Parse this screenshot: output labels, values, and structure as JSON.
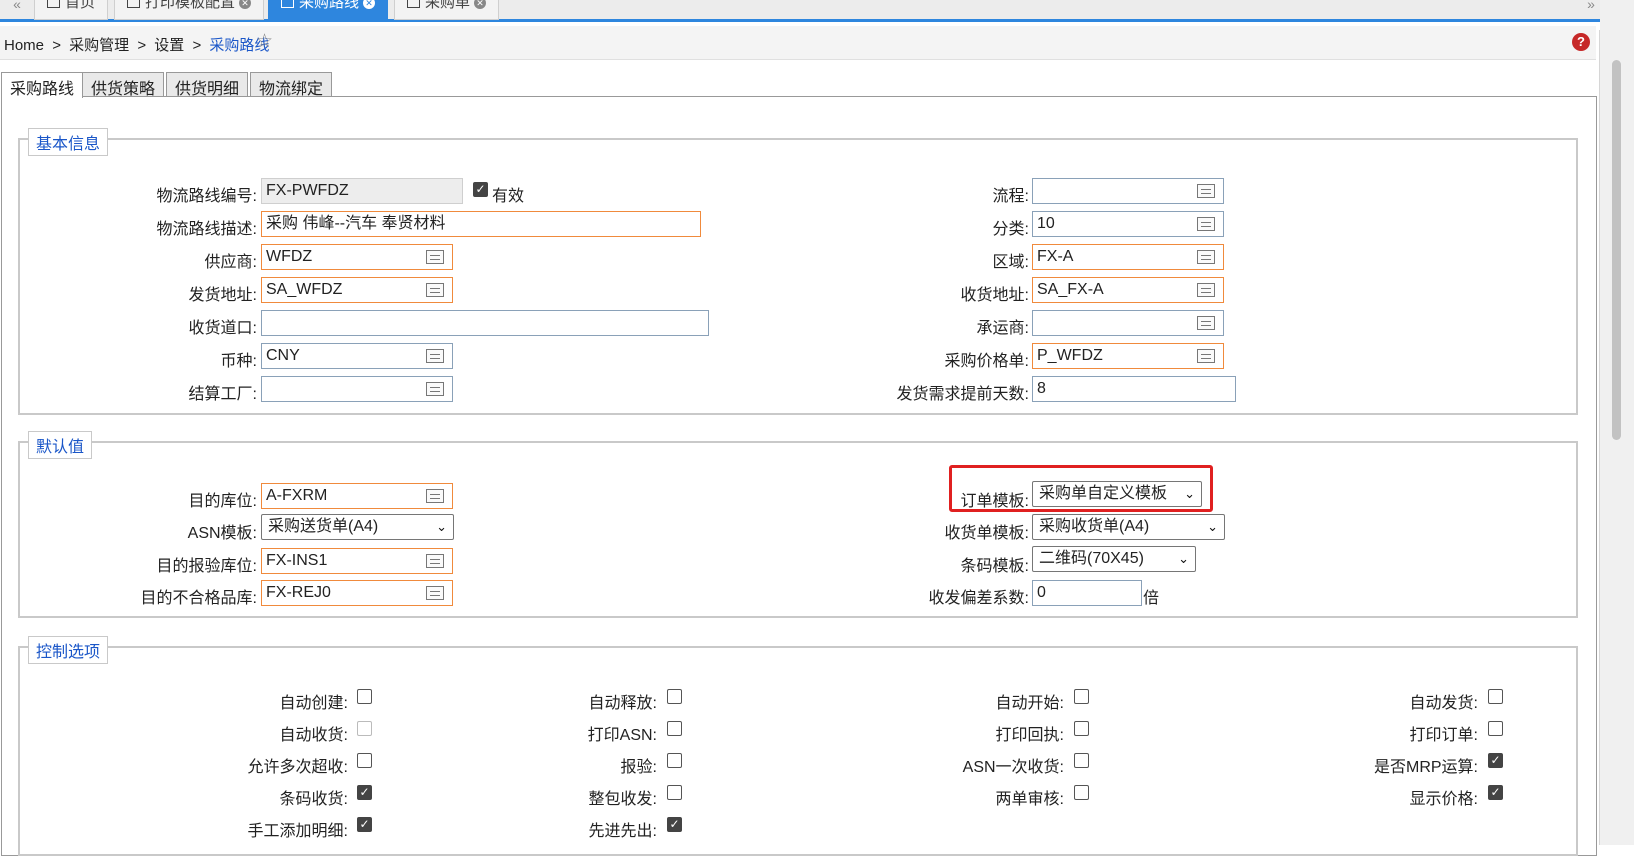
{
  "top_tabs": [
    {
      "label": "首页",
      "active": false
    },
    {
      "label": "打印模板配置",
      "active": false
    },
    {
      "label": "采购路线",
      "active": true
    },
    {
      "label": "采购单",
      "active": false
    }
  ],
  "breadcrumb": {
    "home": "Home",
    "sep": ">",
    "level1": "采购管理",
    "level2": "设置",
    "current": "采购路线"
  },
  "page_tabs": [
    "采购路线",
    "供货策略",
    "供货明细",
    "物流绑定"
  ],
  "basic": {
    "legend": "基本信息",
    "route_code_label": "物流路线编号:",
    "route_code": "FX-PWFDZ",
    "valid_label": "有效",
    "valid": true,
    "desc_label": "物流路线描述:",
    "desc": "采购 伟峰--汽车 奉贤材料",
    "supplier_label": "供应商:",
    "supplier": "WFDZ",
    "ship_addr_label": "发货地址:",
    "ship_addr": "SA_WFDZ",
    "dock_label": "收货道口:",
    "dock": "",
    "currency_label": "币种:",
    "currency": "CNY",
    "settle_factory_label": "结算工厂:",
    "settle_factory": "",
    "flow_label": "流程:",
    "flow": "",
    "category_label": "分类:",
    "category": "10",
    "region_label": "区域:",
    "region": "FX-A",
    "recv_addr_label": "收货地址:",
    "recv_addr": "SA_FX-A",
    "carrier_label": "承运商:",
    "carrier": "",
    "price_list_label": "采购价格单:",
    "price_list": "P_WFDZ",
    "lead_days_label": "发货需求提前天数:",
    "lead_days": "8"
  },
  "defaults": {
    "legend": "默认值",
    "dest_loc_label": "目的库位:",
    "dest_loc": "A-FXRM",
    "asn_tpl_label": "ASN模板:",
    "asn_tpl": "采购送货单(A4)",
    "inspect_loc_label": "目的报验库位:",
    "inspect_loc": "FX-INS1",
    "reject_loc_label": "目的不合格品库:",
    "reject_loc": "FX-REJ0",
    "order_tpl_label": "订单模板:",
    "order_tpl": "采购单自定义模板",
    "recv_tpl_label": "收货单模板:",
    "recv_tpl": "采购收货单(A4)",
    "barcode_tpl_label": "条码模板:",
    "barcode_tpl": "二维码(70X45)",
    "deviation_label": "收发偏差系数:",
    "deviation": "0",
    "deviation_unit": "倍"
  },
  "controls": {
    "legend": "控制选项",
    "items": [
      {
        "label": "自动创建:",
        "checked": false
      },
      {
        "label": "自动释放:",
        "checked": false
      },
      {
        "label": "自动开始:",
        "checked": false
      },
      {
        "label": "自动发货:",
        "checked": false
      },
      {
        "label": "自动收货:",
        "checked": false,
        "disabled": true
      },
      {
        "label": "打印ASN:",
        "checked": false
      },
      {
        "label": "打印回执:",
        "checked": false
      },
      {
        "label": "打印订单:",
        "checked": false
      },
      {
        "label": "允许多次超收:",
        "checked": false
      },
      {
        "label": "报验:",
        "checked": false
      },
      {
        "label": "ASN一次收货:",
        "checked": false
      },
      {
        "label": "是否MRP运算:",
        "checked": true
      },
      {
        "label": "条码收货:",
        "checked": true
      },
      {
        "label": "整包收发:",
        "checked": false
      },
      {
        "label": "两单审核:",
        "checked": false
      },
      {
        "label": "显示价格:",
        "checked": true
      },
      {
        "label": "手工添加明细:",
        "checked": true
      },
      {
        "label": "先进先出:",
        "checked": true
      }
    ]
  },
  "icons": {
    "star": "☆",
    "help": "?",
    "check": "✓",
    "chevron": "⌄",
    "nav_left": "«",
    "nav_right": "»",
    "close": "✕"
  }
}
